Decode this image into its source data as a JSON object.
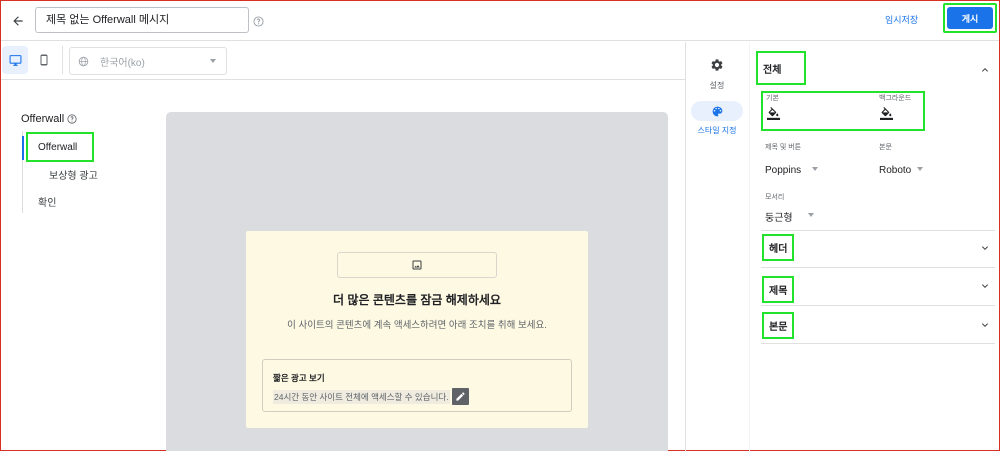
{
  "header": {
    "message_title": "제목 없는 Offerwall 메시지",
    "draft_label": "임시저장",
    "publish_label": "게시"
  },
  "toolbar": {
    "language": "한국어(ko)"
  },
  "nav": {
    "heading": "Offerwall",
    "items": [
      {
        "label": "Offerwall",
        "active": true
      },
      {
        "label": "보상형 광고",
        "active": false
      },
      {
        "label": "확인",
        "active": false
      }
    ]
  },
  "preview": {
    "title": "더 많은 콘텐츠를 잠금 해제하세요",
    "description": "이 사이트의 콘텐츠에 계속 액세스하려면 아래 조치를 취해 보세요.",
    "option_title": "짧은 광고 보기",
    "option_description": "24시간 동안 사이트 전체에 액세스할 수 있습니다."
  },
  "rail": {
    "settings_label": "설정",
    "style_label": "스타일 지정"
  },
  "style_panel": {
    "overall": {
      "label": "전체",
      "default_color_label": "기본",
      "background_color_label": "백그라운드",
      "title_button_font_label": "제목 및 버튼",
      "title_button_font": "Poppins",
      "body_font_label": "본문",
      "body_font": "Roboto",
      "corner_label": "모서리",
      "corner_value": "둥근형"
    },
    "sections": [
      {
        "label": "헤더"
      },
      {
        "label": "제목"
      },
      {
        "label": "본문"
      }
    ]
  },
  "colors": {
    "accent": "#1a73e8",
    "highlight": "#22e22c",
    "card_background": "#fdf9e3",
    "canvas": "#dadce0"
  }
}
